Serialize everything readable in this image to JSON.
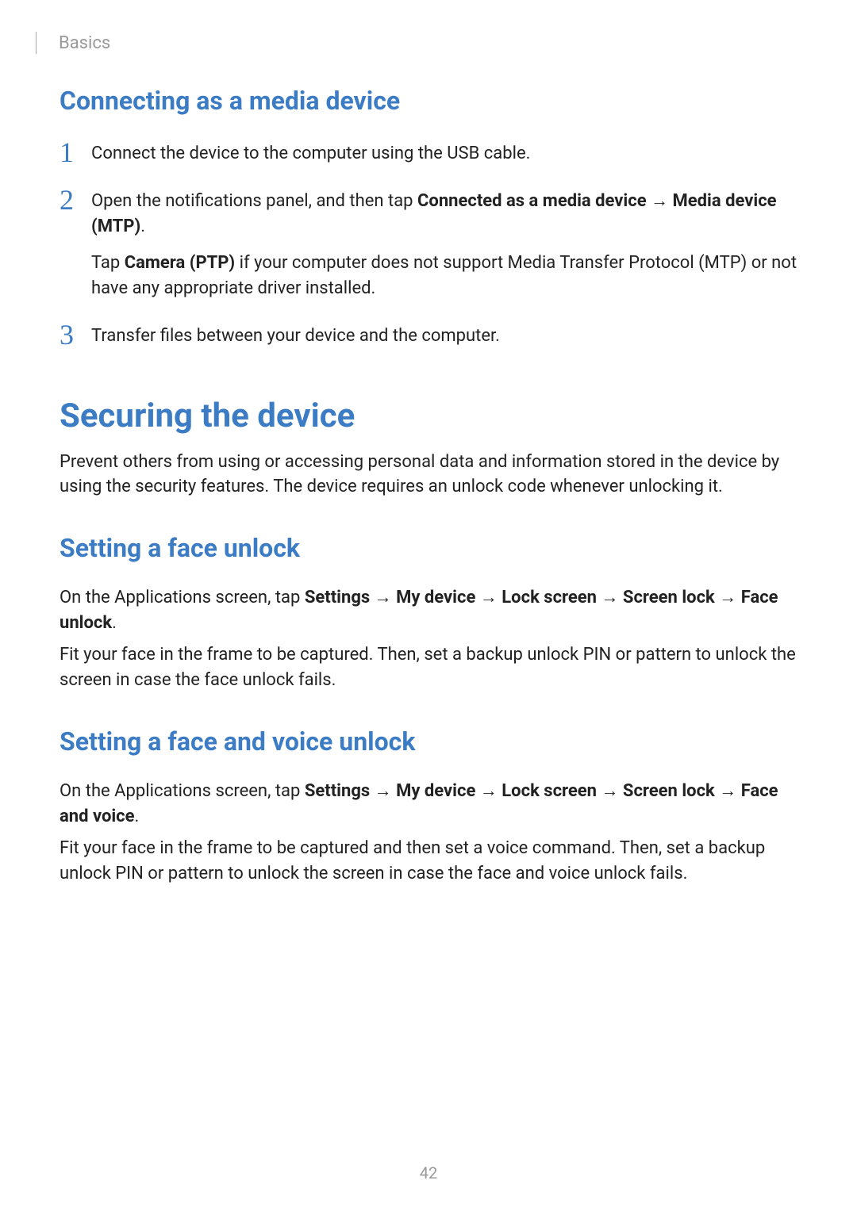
{
  "header": {
    "section": "Basics"
  },
  "section1": {
    "heading": "Connecting as a media device",
    "steps": {
      "s1": {
        "num": "1",
        "text": "Connect the device to the computer using the USB cable."
      },
      "s2": {
        "num": "2",
        "pre": "Open the notifications panel, and then tap ",
        "b1": "Connected as a media device",
        "arrow1": " → ",
        "b2": "Media device (MTP)",
        "post": ".",
        "sub_pre": "Tap ",
        "sub_b": "Camera (PTP)",
        "sub_post": " if your computer does not support Media Transfer Protocol (MTP) or not have any appropriate driver installed."
      },
      "s3": {
        "num": "3",
        "text": "Transfer files between your device and the computer."
      }
    }
  },
  "section2": {
    "heading": "Securing the device",
    "intro": "Prevent others from using or accessing personal data and information stored in the device by using the security features. The device requires an unlock code whenever unlocking it.",
    "face": {
      "heading": "Setting a face unlock",
      "p1_pre": "On the Applications screen, tap ",
      "p1_b1": "Settings",
      "p1_a1": " → ",
      "p1_b2": "My device",
      "p1_a2": " → ",
      "p1_b3": "Lock screen",
      "p1_a3": " → ",
      "p1_b4": "Screen lock",
      "p1_a4": " → ",
      "p1_b5": "Face unlock",
      "p1_post": ".",
      "p2": "Fit your face in the frame to be captured. Then, set a backup unlock PIN or pattern to unlock the screen in case the face unlock fails."
    },
    "facevoice": {
      "heading": "Setting a face and voice unlock",
      "p1_pre": "On the Applications screen, tap ",
      "p1_b1": "Settings",
      "p1_a1": " → ",
      "p1_b2": "My device",
      "p1_a2": " → ",
      "p1_b3": "Lock screen",
      "p1_a3": " → ",
      "p1_b4": "Screen lock",
      "p1_a4": " → ",
      "p1_b5": "Face and voice",
      "p1_post": ".",
      "p2": "Fit your face in the frame to be captured and then set a voice command. Then, set a backup unlock PIN or pattern to unlock the screen in case the face and voice unlock fails."
    }
  },
  "page_number": "42"
}
